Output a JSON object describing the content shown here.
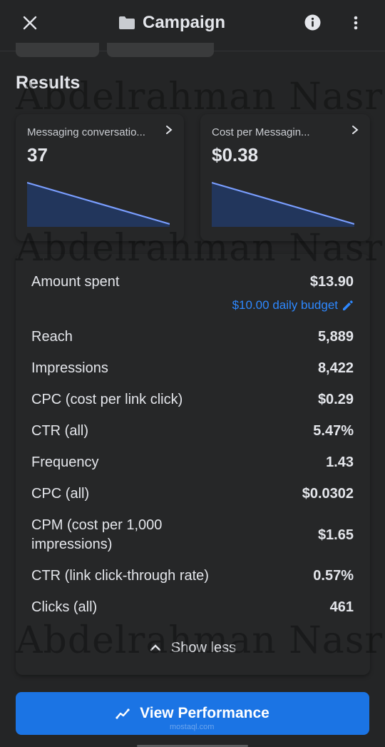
{
  "header": {
    "title": "Campaign",
    "close_icon": "close-icon",
    "folder_icon": "folder-icon",
    "info_icon": "info-icon",
    "more_icon": "more-vertical-icon"
  },
  "section_title": "Results",
  "metric_cards": [
    {
      "label": "Messaging conversatio...",
      "value": "37",
      "trend": [
        1.0,
        0.0
      ]
    },
    {
      "label": "Cost per Messagin...",
      "value": "$0.38",
      "trend": [
        1.0,
        0.0
      ]
    }
  ],
  "details": {
    "amount_spent": {
      "label": "Amount spent",
      "value": "$13.90"
    },
    "budget_link": "$10.00 daily budget",
    "rows": [
      {
        "label": "Reach",
        "value": "5,889"
      },
      {
        "label": "Impressions",
        "value": "8,422"
      },
      {
        "label": "CPC (cost per link click)",
        "value": "$0.29"
      },
      {
        "label": "CTR (all)",
        "value": "5.47%"
      },
      {
        "label": "Frequency",
        "value": "1.43"
      },
      {
        "label": "CPC (all)",
        "value": "$0.0302"
      },
      {
        "label": "CPM (cost per 1,000 impressions)",
        "value": "$1.65"
      },
      {
        "label": "CTR (link click-through rate)",
        "value": "0.57%"
      },
      {
        "label": "Clicks (all)",
        "value": "461"
      }
    ],
    "show_less": "Show less"
  },
  "cta": {
    "label": "View Performance"
  },
  "watermarks": [
    "Abdelrahman Nasr",
    "Abdelrahman Nasr",
    "Abdelrahman Nasr"
  ],
  "footer_watermark": "mostaql.com",
  "colors": {
    "background": "#242526",
    "card": "#262728",
    "accent": "#1b74e4",
    "link": "#2d88ff",
    "spark_line": "#7a9eff",
    "spark_fill": "#22365c"
  }
}
